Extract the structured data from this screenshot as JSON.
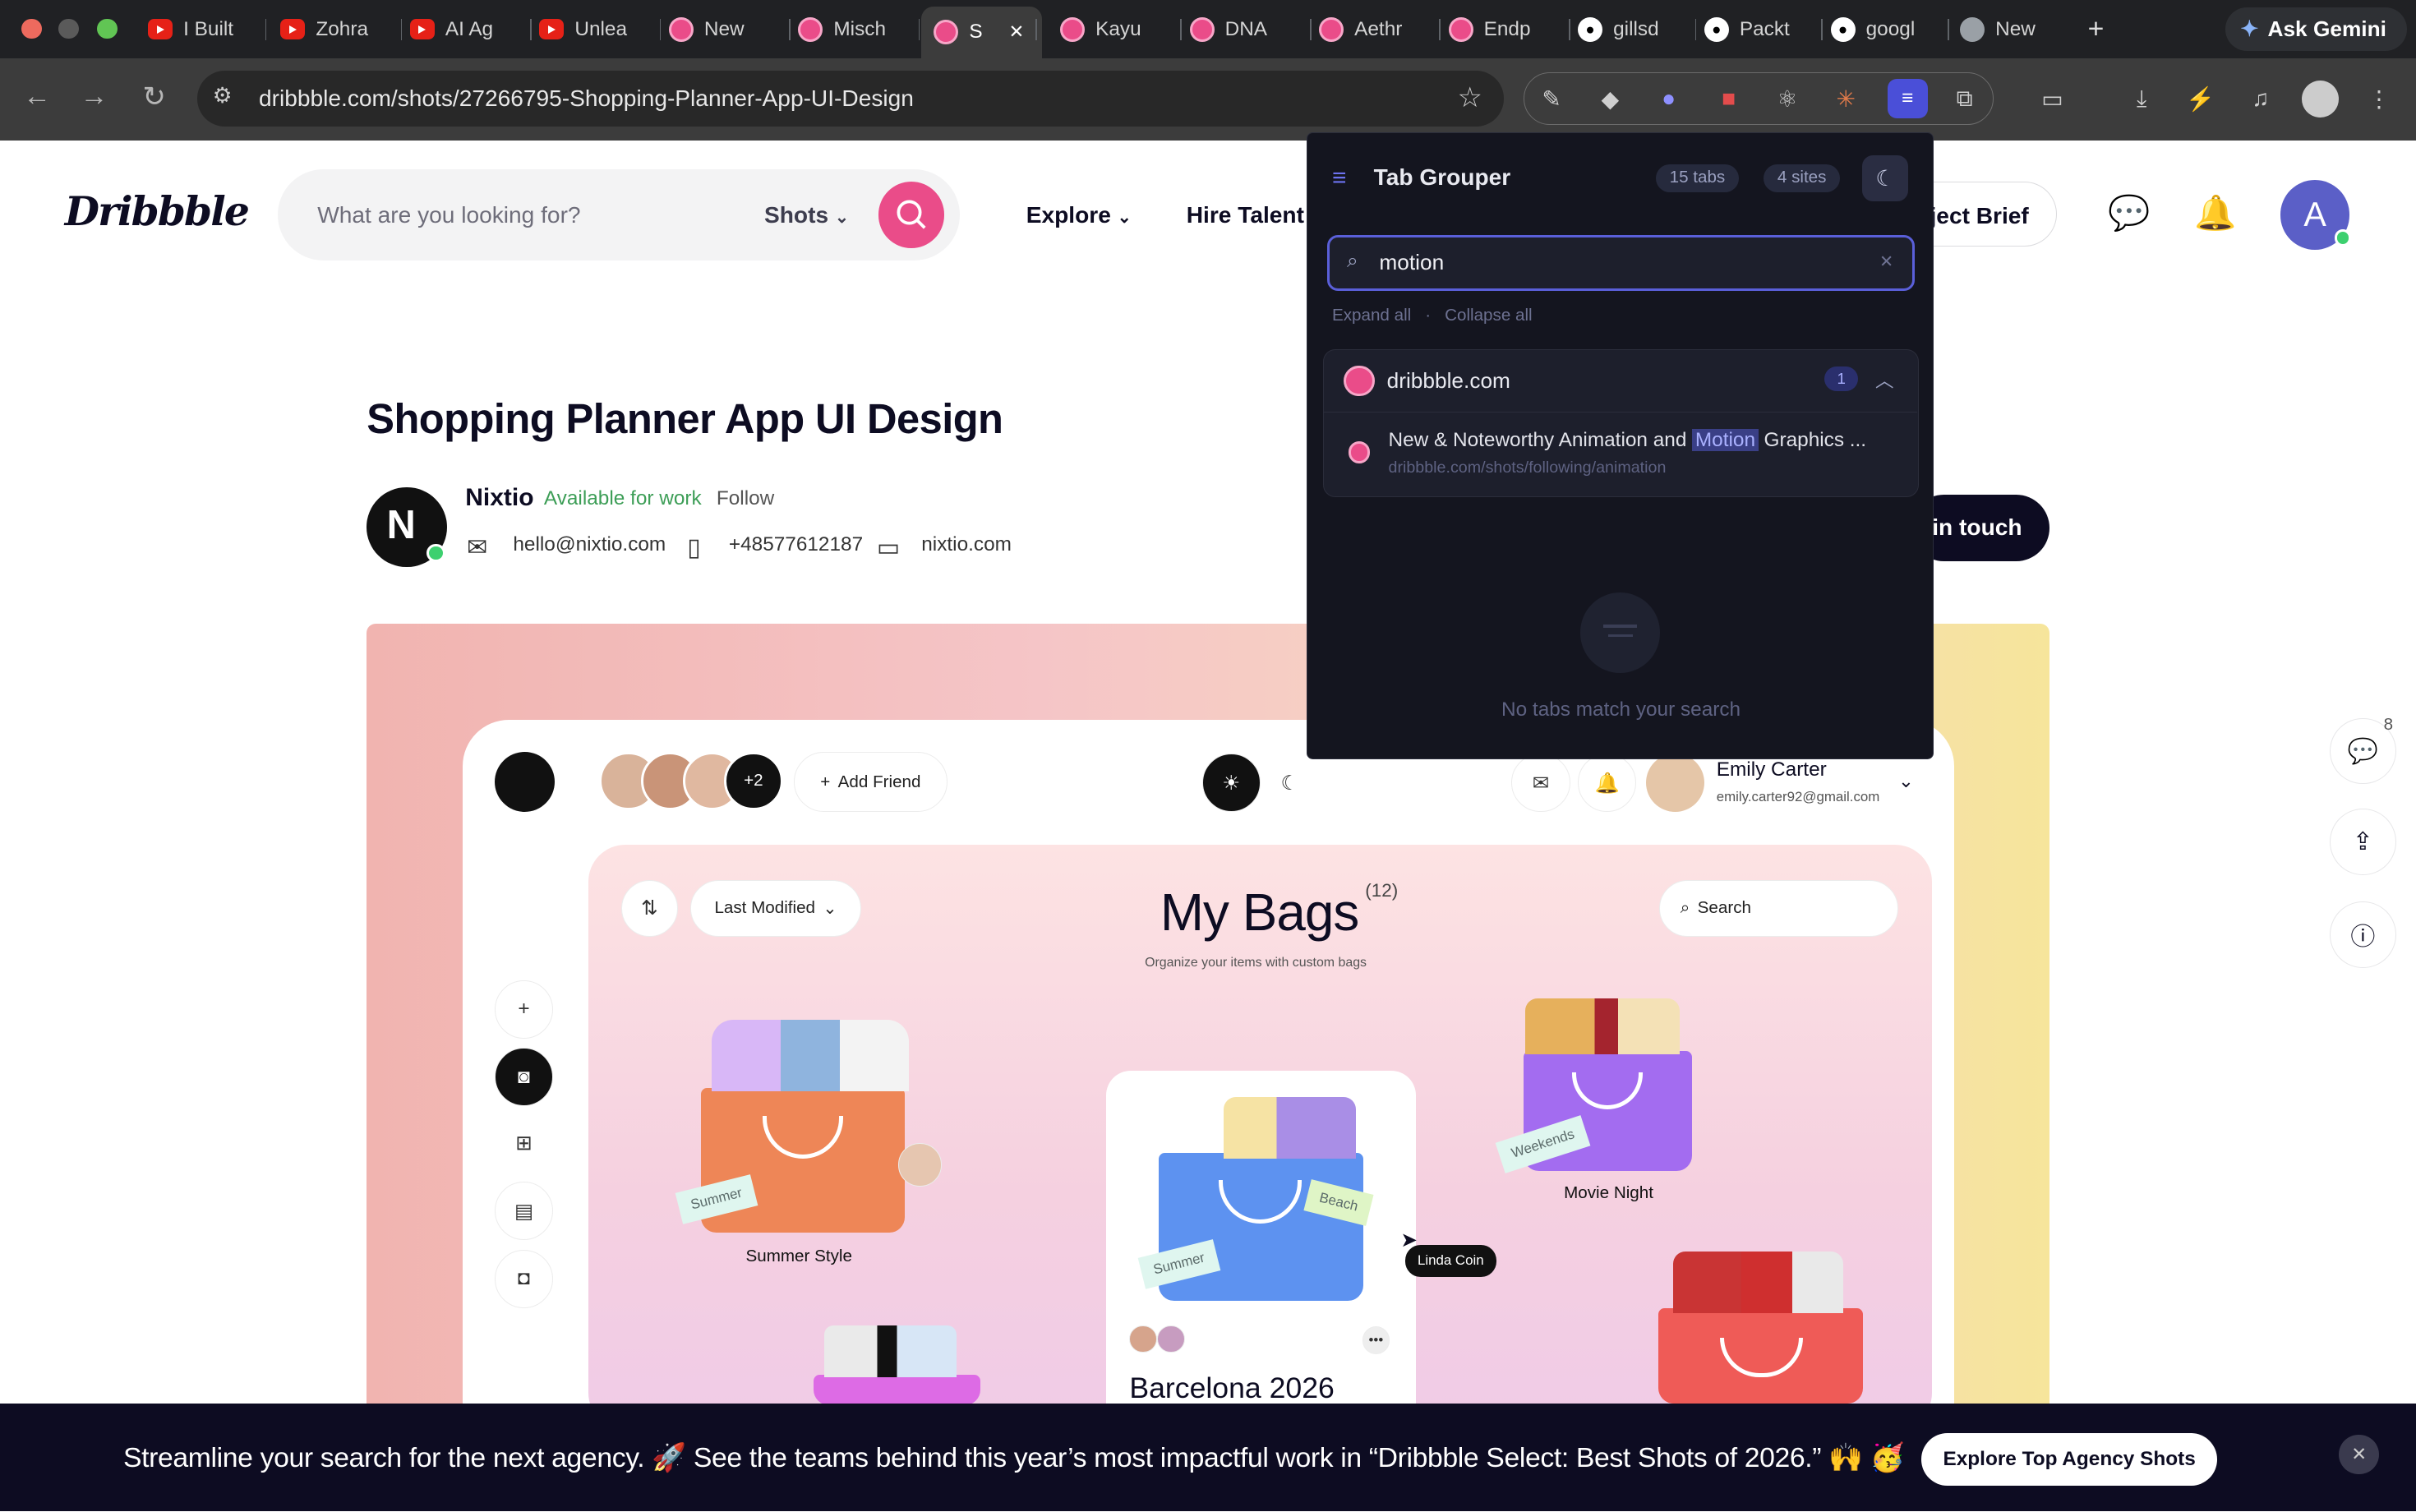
{
  "browser": {
    "tabs": [
      {
        "label": "I Built",
        "icon": "youtube-icon"
      },
      {
        "label": "Zohra",
        "icon": "youtube-icon"
      },
      {
        "label": "AI Ag",
        "icon": "youtube-icon"
      },
      {
        "label": "Unlea",
        "icon": "youtube-icon"
      },
      {
        "label": "New",
        "icon": "dribbble-icon"
      },
      {
        "label": "Misch",
        "icon": "dribbble-icon"
      },
      {
        "label": "S",
        "icon": "dribbble-icon"
      },
      {
        "label": "Kayu",
        "icon": "dribbble-icon"
      },
      {
        "label": "DNA",
        "icon": "dribbble-icon"
      },
      {
        "label": "Aethr",
        "icon": "dribbble-icon"
      },
      {
        "label": "Endp",
        "icon": "dribbble-icon"
      },
      {
        "label": "gillsd",
        "icon": "github-icon"
      },
      {
        "label": "Packt",
        "icon": "github-icon"
      },
      {
        "label": "googl",
        "icon": "github-icon"
      },
      {
        "label": "New",
        "icon": "chrome-icon"
      }
    ],
    "active_tab_close": "✕",
    "new_tab": "+",
    "gemini_label": "Ask Gemini",
    "url": "dribbble.com/shots/27266795-Shopping-Planner-App-UI-Design"
  },
  "site": {
    "logo": "Dribbble",
    "search_placeholder": "What are you looking for?",
    "search_scope": "Shots",
    "nav": {
      "explore": "Explore",
      "hire": "Hire Talent",
      "brief": "ject Brief"
    },
    "avatar_letter": "A",
    "shot_title": "Shopping Planner App UI Design",
    "author": "Nixtio",
    "availability": "Available for work",
    "follow": "Follow",
    "email": "hello@nixtio.com",
    "phone": "+48577612187",
    "website": "nixtio.com",
    "get_in_touch": "in touch",
    "side_count": "8"
  },
  "shot": {
    "face_extra": "+2",
    "add_friend": "Add Friend",
    "user_name": "Emily Carter",
    "user_email": "emily.carter92@gmail.com",
    "sort": "Last Modified",
    "title": "My Bags",
    "count": "(12)",
    "subtitle": "Organize your items with custom bags",
    "search": "Search",
    "bags": {
      "summer_style": "Summer Style",
      "movie_night": "Movie Night",
      "barcelona": "Barcelona 2026"
    },
    "tags": {
      "summer": "Summer",
      "beach": "Beach",
      "weekends": "Weekends"
    },
    "cursor_label": "Linda Coin"
  },
  "tab_grouper": {
    "title": "Tab Grouper",
    "tabs_badge": "15 tabs",
    "sites_badge": "4 sites",
    "search_value": "motion",
    "expand": "Expand all",
    "dot": "·",
    "collapse": "Collapse all",
    "group_domain": "dribbble.com",
    "group_count": "1",
    "item_title_pre": "New & Noteworthy Animation and ",
    "item_title_hl": "Motion",
    "item_title_post": " Graphics ...",
    "item_url": "dribbble.com/shots/following/animation",
    "empty": "No tabs match your search"
  },
  "banner": {
    "text": "Streamline your search for the next agency. 🚀 See the teams behind this year’s most impactful work in “Dribbble Select: Best Shots of 2026.” 🙌 🥳",
    "cta": "Explore Top Agency Shots",
    "close": "✕"
  }
}
